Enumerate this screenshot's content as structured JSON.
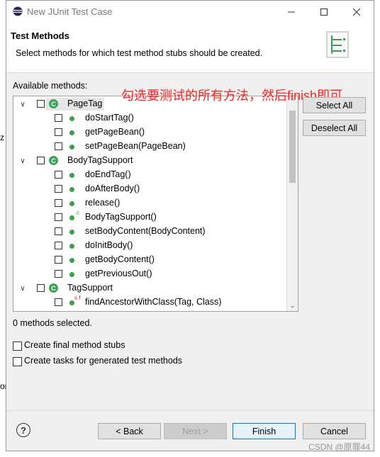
{
  "window": {
    "title": "New JUnit Test Case"
  },
  "header": {
    "title": "Test Methods",
    "description": "Select methods for which test method stubs should be created."
  },
  "available_label": "Available methods:",
  "annotation": "勾选要测试的所有方法，然后finish即可",
  "tree": [
    {
      "kind": "class",
      "label": "PageTag",
      "expanded": true
    },
    {
      "kind": "method",
      "label": "doStartTag()"
    },
    {
      "kind": "method",
      "label": "getPageBean()"
    },
    {
      "kind": "method",
      "label": "setPageBean(PageBean)"
    },
    {
      "kind": "class",
      "label": "BodyTagSupport",
      "expanded": true
    },
    {
      "kind": "method",
      "label": "doEndTag()"
    },
    {
      "kind": "method",
      "label": "doAfterBody()"
    },
    {
      "kind": "method",
      "label": "release()"
    },
    {
      "kind": "method",
      "label": "BodyTagSupport()",
      "badge": "c"
    },
    {
      "kind": "method",
      "label": "setBodyContent(BodyContent)"
    },
    {
      "kind": "method",
      "label": "doInitBody()"
    },
    {
      "kind": "method",
      "label": "getBodyContent()"
    },
    {
      "kind": "method",
      "label": "getPreviousOut()"
    },
    {
      "kind": "class",
      "label": "TagSupport",
      "expanded": true
    },
    {
      "kind": "method",
      "label": "findAncestorWithClass(Tag, Class)",
      "badge": "s f"
    }
  ],
  "buttons": {
    "select_all": "Select All",
    "deselect_all": "Deselect All",
    "back": "< Back",
    "next": "Next >",
    "finish": "Finish",
    "cancel": "Cancel"
  },
  "status": "0 methods selected.",
  "options": [
    {
      "label": "Create final method stubs",
      "checked": false
    },
    {
      "label": "Create tasks for generated test methods",
      "checked": false
    }
  ],
  "watermark": "CSDN @原罪44",
  "side_fragments": [
    "z",
    "or"
  ],
  "colors": {
    "annotation": "#ff2020",
    "class_icon": "#3ea35b",
    "primary_border": "#0078d7"
  }
}
